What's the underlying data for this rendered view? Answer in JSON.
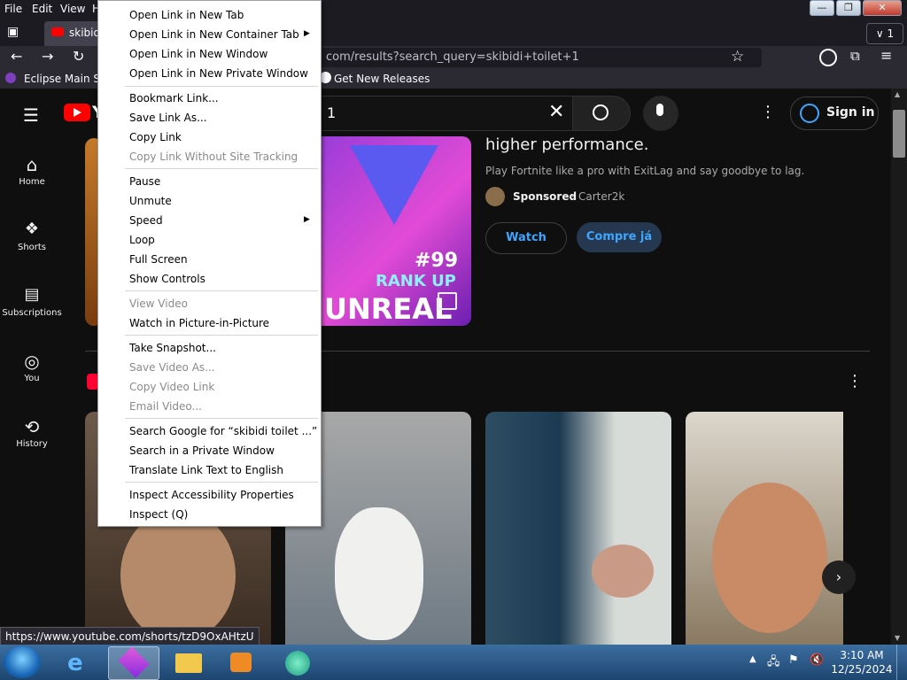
{
  "menubar": {
    "file": "File",
    "edit": "Edit",
    "view": "View",
    "history_stub": "H"
  },
  "tabs": {
    "active_title": "skibidi",
    "all_tabs_count": "1"
  },
  "urlbar": {
    "value": "com/results?search_query=skibidi+toilet+1"
  },
  "bookmarks": {
    "item1": "Eclipse Main Sit",
    "item2": "Get New Releases"
  },
  "youtube": {
    "logo_stub": "Y",
    "search_value": "1",
    "signin": "Sign in",
    "nav": [
      {
        "label": "Home",
        "icon": "home-icon"
      },
      {
        "label": "Shorts",
        "icon": "shorts-icon"
      },
      {
        "label": "Subscriptions",
        "icon": "subscriptions-icon"
      },
      {
        "label": "You",
        "icon": "you-icon"
      },
      {
        "label": "History",
        "icon": "history-icon"
      }
    ],
    "ad": {
      "headline": "higher performance.",
      "description": "Play Fortnite like a pro with ExitLag and say goodbye to lag.",
      "sponsored": "Sponsored",
      "advertiser": "Carter2k",
      "watch_label": "Watch",
      "buy_label": "Compre já",
      "thumb_badge": "#99",
      "thumb_line1": "RANK UP",
      "thumb_line2": "UNREAL"
    }
  },
  "context_menu": {
    "items": [
      {
        "label": "Open Link in New Tab",
        "disabled": false
      },
      {
        "label": "Open Link in New Container Tab",
        "disabled": false,
        "submenu": true
      },
      {
        "label": "Open Link in New Window",
        "disabled": false
      },
      {
        "label": "Open Link in New Private Window",
        "disabled": false
      },
      {
        "label": "Bookmark Link...",
        "disabled": false
      },
      {
        "label": "Save Link As...",
        "disabled": false
      },
      {
        "label": "Copy Link",
        "disabled": false
      },
      {
        "label": "Copy Link Without Site Tracking",
        "disabled": true
      },
      {
        "label": "Pause",
        "disabled": false
      },
      {
        "label": "Unmute",
        "disabled": false
      },
      {
        "label": "Speed",
        "disabled": false,
        "submenu": true
      },
      {
        "label": "Loop",
        "disabled": false
      },
      {
        "label": "Full Screen",
        "disabled": false
      },
      {
        "label": "Show Controls",
        "disabled": false
      },
      {
        "label": "View Video",
        "disabled": true
      },
      {
        "label": "Watch in Picture-in-Picture",
        "disabled": false
      },
      {
        "label": "Take Snapshot...",
        "disabled": false
      },
      {
        "label": "Save Video As...",
        "disabled": true
      },
      {
        "label": "Copy Video Link",
        "disabled": true
      },
      {
        "label": "Email Video...",
        "disabled": true
      },
      {
        "label": "Search Google for “skibidi toilet ...”",
        "disabled": false
      },
      {
        "label": "Search in a Private Window",
        "disabled": false
      },
      {
        "label": "Translate Link Text to English",
        "disabled": false
      },
      {
        "label": "Inspect Accessibility Properties",
        "disabled": false
      },
      {
        "label": "Inspect (Q)",
        "disabled": false
      }
    ]
  },
  "status_url": "https://www.youtube.com/shorts/tzD9OxAHtzU",
  "taskbar": {
    "time": "3:10 AM",
    "date": "12/25/2024"
  },
  "colors": {
    "yt_bg": "#0f0f0f",
    "watch_btn": "#263850",
    "accent_blue": "#3ea6ff",
    "ctx_bg": "#ffffff",
    "taskbar": "#1d4670"
  }
}
